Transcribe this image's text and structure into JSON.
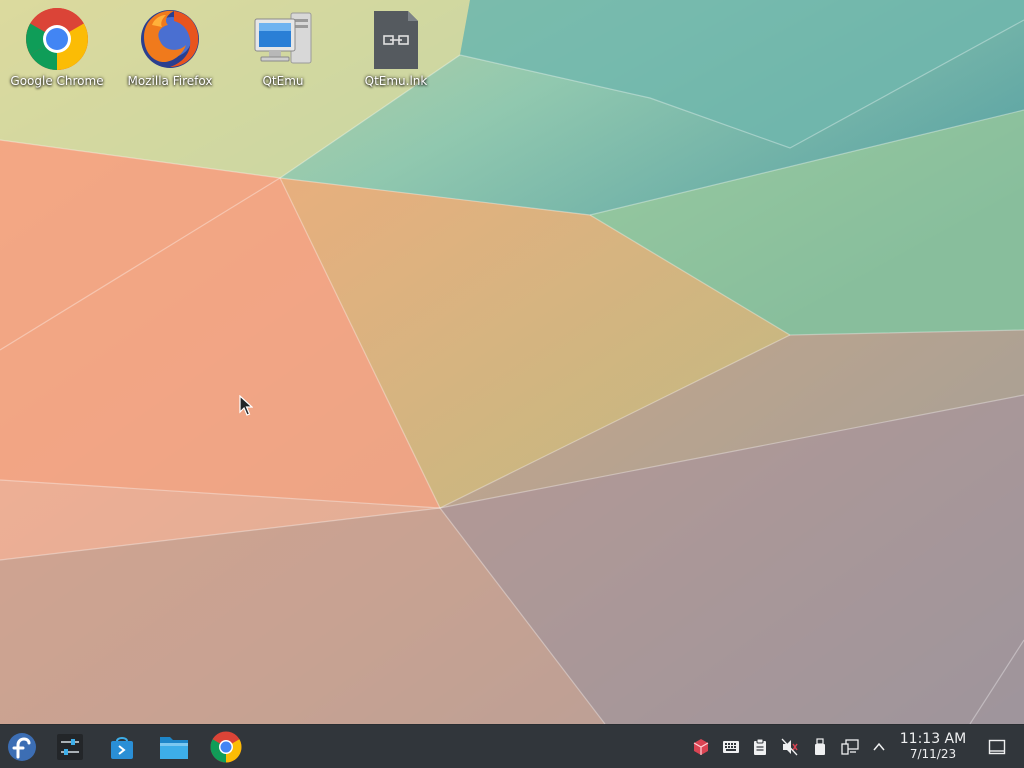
{
  "desktop": {
    "icons": [
      {
        "label": "Google Chrome",
        "icon": "chrome-icon"
      },
      {
        "label": "Mozilla Firefox",
        "icon": "firefox-icon"
      },
      {
        "label": "QtEmu",
        "icon": "computer-icon"
      },
      {
        "label": "QtEmu.lnk",
        "icon": "link-file-icon"
      }
    ]
  },
  "taskbar": {
    "launchers": [
      {
        "icon": "fedora-logo-icon"
      },
      {
        "icon": "system-settings-icon"
      },
      {
        "icon": "discover-store-icon"
      },
      {
        "icon": "file-manager-icon"
      },
      {
        "icon": "chrome-icon"
      }
    ],
    "tray": [
      {
        "icon": "package-updates-icon"
      },
      {
        "icon": "keyboard-icon"
      },
      {
        "icon": "clipboard-icon"
      },
      {
        "icon": "volume-muted-icon"
      },
      {
        "icon": "usb-drive-icon"
      },
      {
        "icon": "network-wired-icon"
      },
      {
        "icon": "chevron-up-icon"
      }
    ],
    "clock": {
      "time": "11:13 AM",
      "date": "7/11/23"
    },
    "show_desktop": {
      "icon": "show-desktop-icon"
    }
  },
  "colors": {
    "taskbar_bg": "#31363b",
    "accent": "#3daee9"
  }
}
